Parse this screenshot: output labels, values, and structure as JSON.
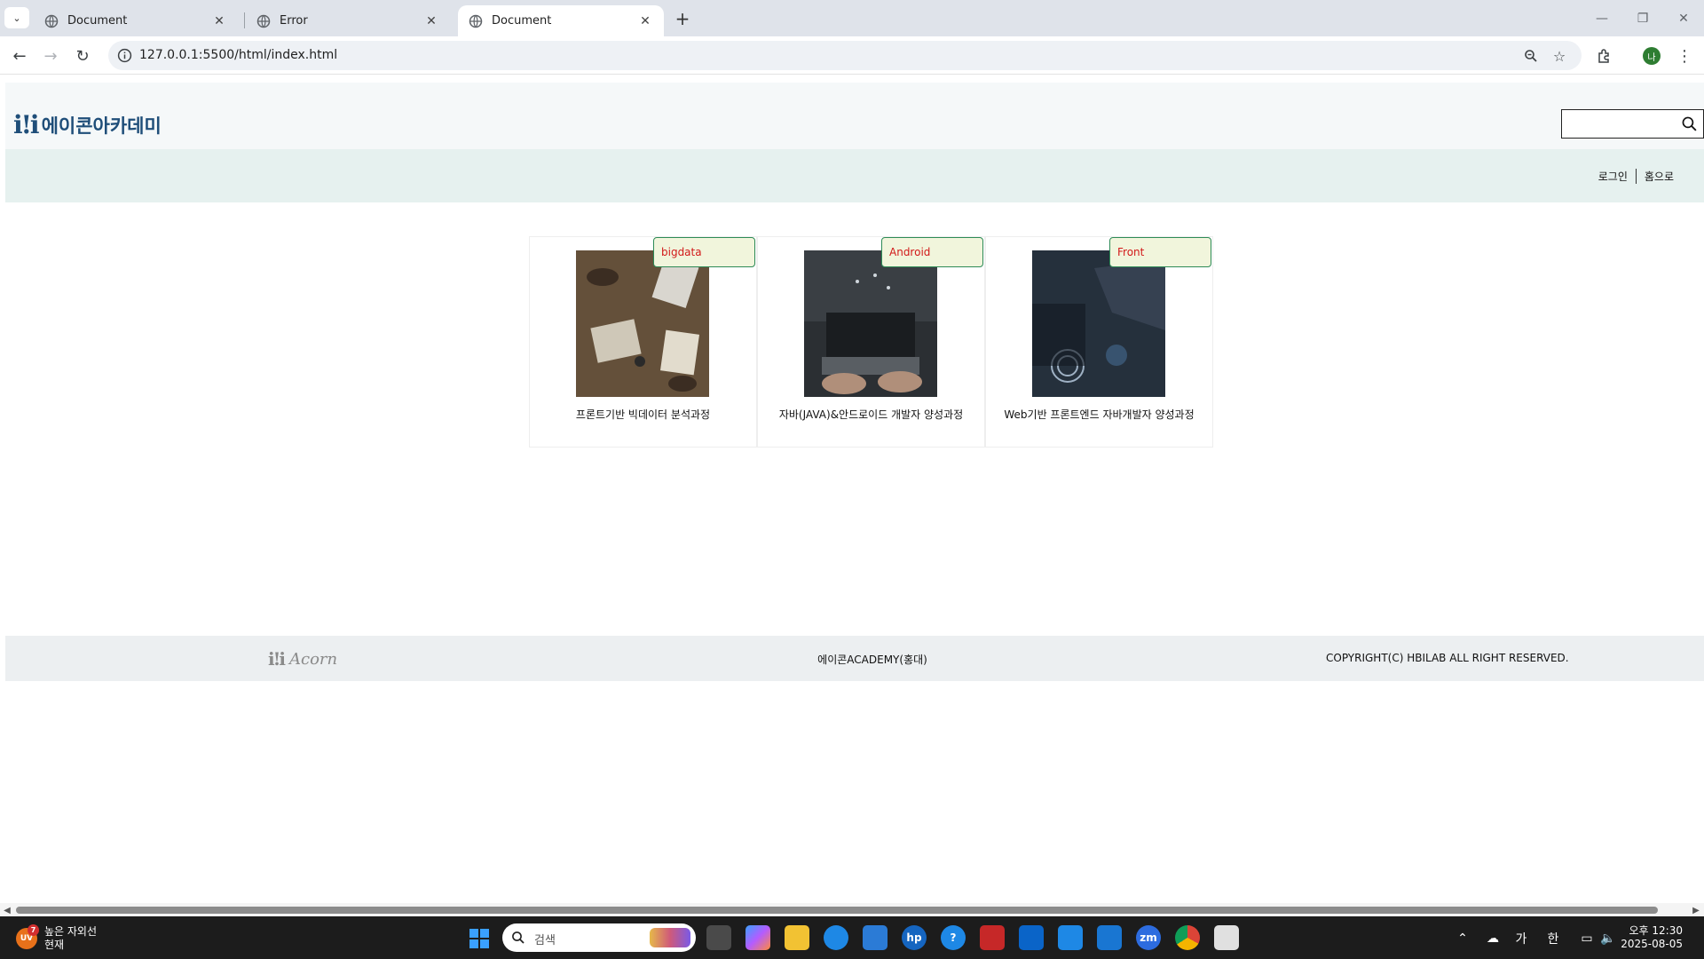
{
  "browser": {
    "tabs": [
      {
        "label": "Document",
        "close": "✕"
      },
      {
        "label": "Error",
        "close": "✕"
      },
      {
        "label": "Document",
        "close": "✕"
      }
    ],
    "new_tab": "+",
    "address": "127.0.0.1:5500/html/index.html",
    "profile_initial": "나"
  },
  "site": {
    "logo_mark": "i!i",
    "logo_text": "에이콘아카데미",
    "search_value": "",
    "nav": {
      "login": "로그인",
      "home": "홈으로"
    },
    "cards": [
      {
        "badge": "bigdata",
        "title": "프론트기반 빅데이터 분석과정"
      },
      {
        "badge": "Android",
        "title": "자바(JAVA)&안드로이드 개발자 양성과정"
      },
      {
        "badge": "Front",
        "title": "Web기반 프론트엔드 자바개발자 양성과정"
      }
    ],
    "footer": {
      "logo_mark": "i!i",
      "logo_text": "Acorn",
      "center": "에이콘ACADEMY(홍대)",
      "copyright": "COPYRIGHT(C) HBILAB ALL RIGHT RESERVED."
    }
  },
  "taskbar": {
    "weather_badge": "7",
    "weather_icon_text": "UV",
    "weather_title": "높은 자외선",
    "weather_sub": "현재",
    "search_placeholder": "검색",
    "ime_1": "가",
    "ime_2": "한",
    "clock_time": "오후 12:30",
    "clock_date": "2025-08-05"
  },
  "colors": {
    "badge_text": "#d21919",
    "badge_border": "#2e8b57",
    "logo": "#1f4e79",
    "nav_band": "#e6f1ef"
  }
}
